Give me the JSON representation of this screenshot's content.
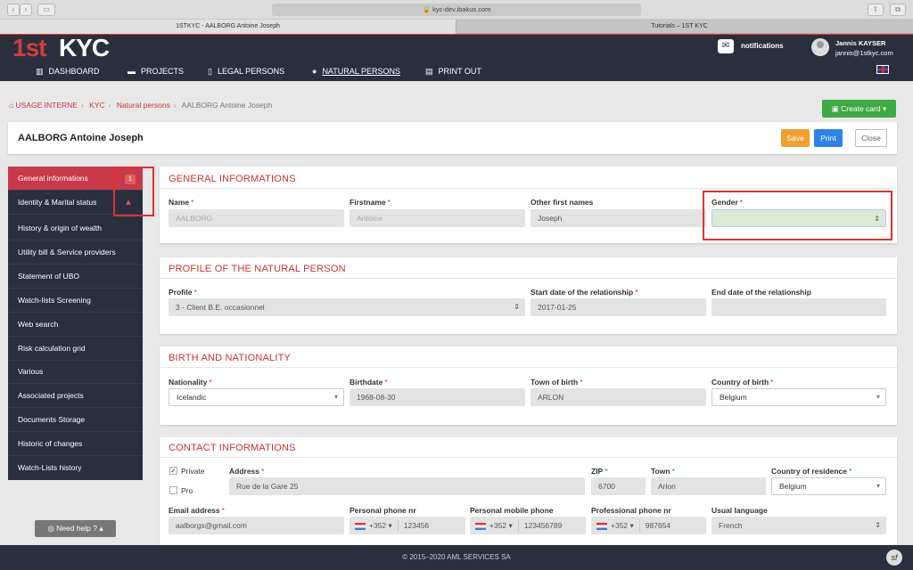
{
  "browser": {
    "url": "kyc-dev.ibakus.com",
    "tab1": "1STKYC - AALBORG Antoine Joseph",
    "tab2": "Tutorials – 1ST KYC"
  },
  "logo": {
    "part1": "1st",
    "part2": "KYC"
  },
  "nav": [
    {
      "label": "DASHBOARD",
      "icon": "chart-icon"
    },
    {
      "label": "PROJECTS",
      "icon": "folder-icon"
    },
    {
      "label": "LEGAL PERSONS",
      "icon": "building-icon"
    },
    {
      "label": "NATURAL PERSONS",
      "icon": "user-icon"
    },
    {
      "label": "PRINT OUT",
      "icon": "document-icon"
    }
  ],
  "header": {
    "notifications": "notifications",
    "user_name": "Jannis KAYSER",
    "user_email": "jannis@1stkyc.com"
  },
  "breadcrumb": {
    "home": "USAGE INTERNE",
    "kyc": "KYC",
    "natural": "Natural persons",
    "current": "AALBORG Antoine Joseph"
  },
  "create_card": "Create card",
  "title": "AALBORG Antoine Joseph",
  "buttons": {
    "save": "Save",
    "print": "Print",
    "close": "Close"
  },
  "sidebar": [
    "General informations",
    "Identity & Marital status",
    "History & origin of wealth",
    "Utility bill & Service providers",
    "Statement of UBO",
    "Watch-lists Screening",
    "Web search",
    "Risk calculation grid",
    "Various",
    "Associated projects",
    "Documents Storage",
    "Historic of changes",
    "Watch-Lists history"
  ],
  "sidebar_badge": "1",
  "need_help": "Need help ?",
  "general": {
    "title": "GENERAL INFORMATIONS",
    "name_label": "Name",
    "name": "AALBORG",
    "firstname_label": "Firstname",
    "firstname": "Antoine",
    "other_label": "Other first names",
    "other": "Joseph",
    "gender_label": "Gender",
    "gender": ""
  },
  "profile": {
    "title": "PROFILE OF THE NATURAL PERSON",
    "profile_label": "Profile",
    "profile": "3 - Client B.E. occasionnel",
    "start_label": "Start date of the relationship",
    "start": "2017-01-25",
    "end_label": "End date of the relationship",
    "end": ""
  },
  "birth": {
    "title": "BIRTH AND NATIONALITY",
    "nat_label": "Nationality",
    "nat": "Icelandic",
    "bd_label": "Birthdate",
    "bd": "1968-08-30",
    "town_label": "Town of birth",
    "town": "ARLON",
    "country_label": "Country of birth",
    "country": "Belgium"
  },
  "contact": {
    "title": "CONTACT INFORMATIONS",
    "private": "Private",
    "pro": "Pro",
    "address_label": "Address",
    "address": "Rue de la Gare 25",
    "zip_label": "ZIP",
    "zip": "6700",
    "town_label": "Town",
    "town": "Arlon",
    "cor_label": "Country of residence",
    "cor": "Belgium",
    "email_label": "Email address",
    "email": "aalborgs@gmail.com",
    "pphone_label": "Personal phone nr",
    "pphone_code": "+352",
    "pphone": "123456",
    "mphone_label": "Personal mobile phone",
    "mphone_code": "+352",
    "mphone": "123456789",
    "prophone_label": "Professional phone nr",
    "prophone_code": "+352",
    "prophone": "987654",
    "lang_label": "Usual language",
    "lang": "French"
  },
  "footer": "© 2015–2020 AML SERVICES SA",
  "colors": {
    "brand_red": "#c9394a",
    "dark": "#2a2f3e",
    "green": "#3fa945",
    "orange": "#f0a030",
    "blue": "#2e82e8"
  }
}
